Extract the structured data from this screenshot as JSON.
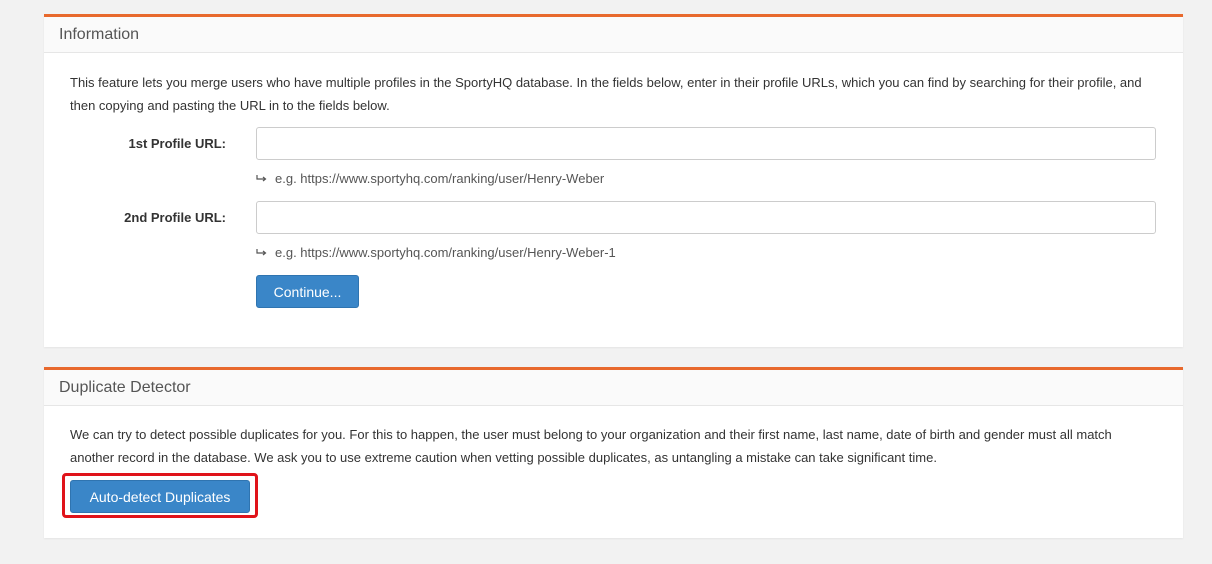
{
  "info_panel": {
    "title": "Information",
    "description": "This feature lets you merge users who have multiple profiles in the SportyHQ database. In the fields below, enter in their profile URLs, which you can find by searching for their profile, and then copying and pasting the URL in to the fields below.",
    "field1": {
      "label": "1st Profile URL:",
      "value": "",
      "hint": "e.g. https://www.sportyhq.com/ranking/user/Henry-Weber"
    },
    "field2": {
      "label": "2nd Profile URL:",
      "value": "",
      "hint": "e.g. https://www.sportyhq.com/ranking/user/Henry-Weber-1"
    },
    "continue_label": "Continue..."
  },
  "dup_panel": {
    "title": "Duplicate Detector",
    "description": "We can try to detect possible duplicates for you. For this to happen, the user must belong to your organization and their first name, last name, date of birth and gender must all match another record in the database. We ask you to use extreme caution when vetting possible duplicates, as untangling a mistake can take significant time.",
    "auto_detect_label": "Auto-detect Duplicates"
  },
  "colors": {
    "accent": "#e8692d",
    "button": "#3a86c8",
    "highlight": "#e0131a"
  },
  "icons": {
    "hint_icon": "return-arrow-icon"
  }
}
